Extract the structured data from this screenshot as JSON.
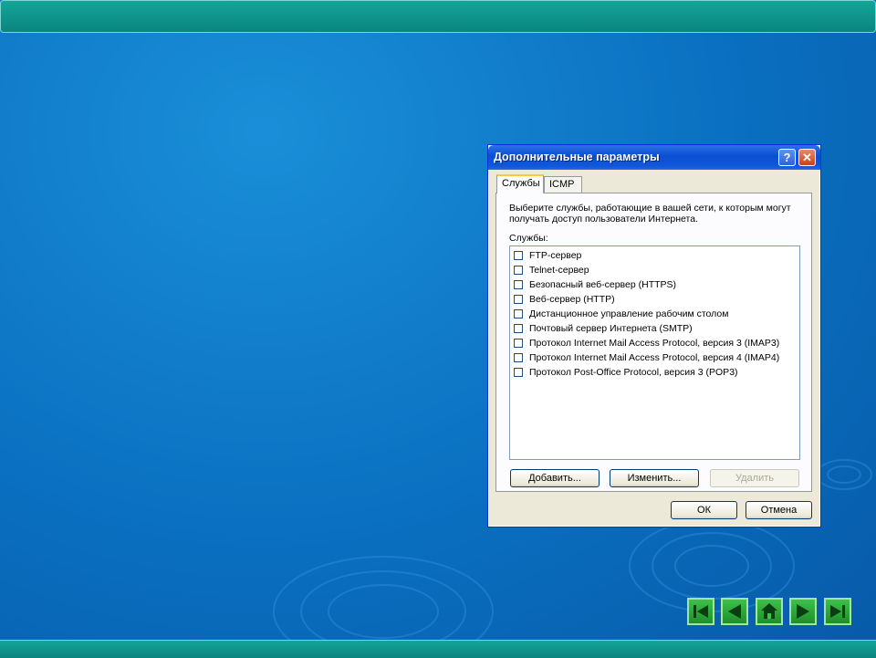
{
  "dialog": {
    "title": "Дополнительные параметры",
    "help_icon": "?",
    "close_icon": "✕",
    "tabs": [
      {
        "label": "Службы",
        "active": true
      },
      {
        "label": "ICMP",
        "active": false
      }
    ],
    "description": "Выберите службы, работающие в вашей сети, к которым могут получать доступ пользователи Интернета.",
    "services_label": "Службы:",
    "services": [
      {
        "label": "FTP-сервер",
        "checked": false
      },
      {
        "label": "Telnet-сервер",
        "checked": false
      },
      {
        "label": "Безопасный веб-сервер (HTTPS)",
        "checked": false
      },
      {
        "label": "Веб-сервер (HTTP)",
        "checked": false
      },
      {
        "label": "Дистанционное управление рабочим столом",
        "checked": false
      },
      {
        "label": "Почтовый сервер Интернета (SMTP)",
        "checked": false
      },
      {
        "label": "Протокол Internet Mail Access Protocol, версия 3 (IMAP3)",
        "checked": false
      },
      {
        "label": "Протокол Internet Mail Access Protocol, версия 4 (IMAP4)",
        "checked": false
      },
      {
        "label": "Протокол Post-Office Protocol, версия 3 (POP3)",
        "checked": false
      }
    ],
    "buttons": {
      "add": "Добавить...",
      "edit": "Изменить...",
      "delete": "Удалить",
      "ok": "ОК",
      "cancel": "Отмена"
    }
  },
  "navigation": {
    "icons": [
      "first-slide-icon",
      "previous-slide-icon",
      "home-icon",
      "next-slide-icon",
      "last-slide-icon"
    ]
  },
  "colors": {
    "accent_bar": "#0b857d",
    "background": "#0a6fc0",
    "titlebar": "#0a4fd2",
    "nav_button": "#1e8f2b"
  }
}
